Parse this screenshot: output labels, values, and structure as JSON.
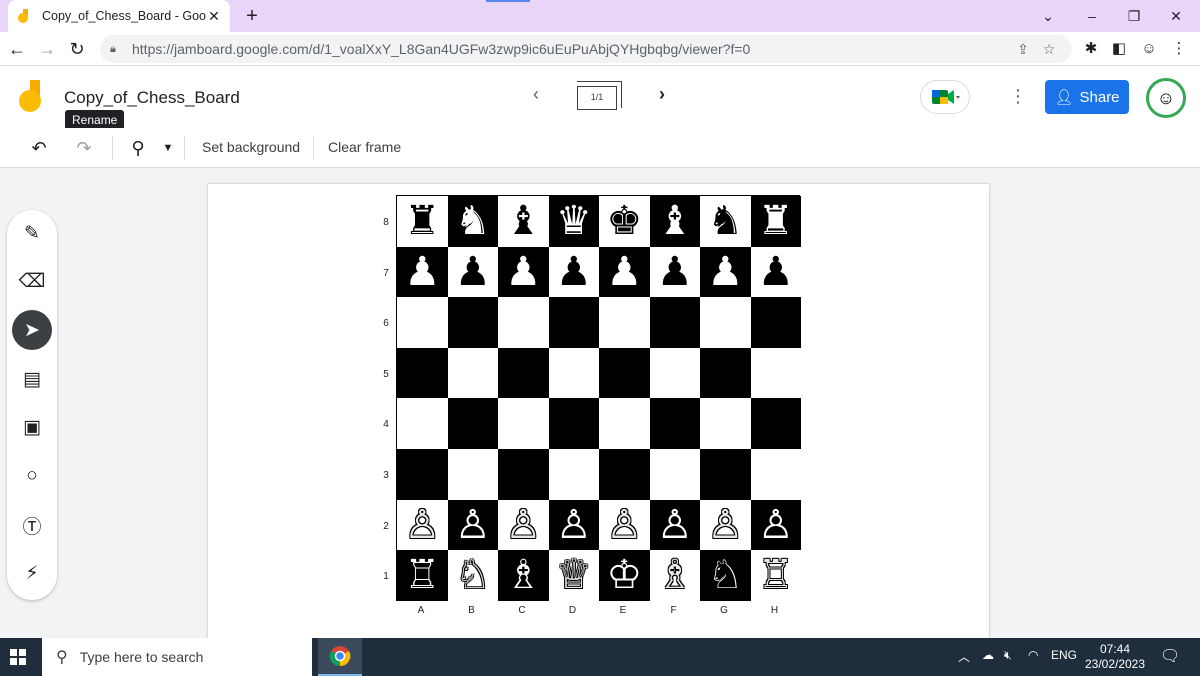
{
  "browser": {
    "tab_title": "Copy_of_Chess_Board - Google Jamboard",
    "url": "https://jamboard.google.com/d/1_voalXxY_L8Gan4UGFw3zwp9ic6uEuPuAbjQYHgbqbg/viewer?f=0"
  },
  "jamboard": {
    "title": "Copy_of_Chess_Board",
    "tooltip": "Rename",
    "frame_indicator": "1/1",
    "share_label": "Share",
    "set_background": "Set background",
    "clear_frame": "Clear frame"
  },
  "board": {
    "ranks": [
      "8",
      "7",
      "6",
      "5",
      "4",
      "3",
      "2",
      "1"
    ],
    "files": [
      "A",
      "B",
      "C",
      "D",
      "E",
      "F",
      "G",
      "H"
    ],
    "rows": [
      [
        "♜",
        "♞",
        "♝",
        "♛",
        "♚",
        "♝",
        "♞",
        "♜"
      ],
      [
        "♟",
        "♟",
        "♟",
        "♟",
        "♟",
        "♟",
        "♟",
        "♟"
      ],
      [
        "",
        "",
        "",
        "",
        "",
        "",
        "",
        ""
      ],
      [
        "",
        "",
        "",
        "",
        "",
        "",
        "",
        ""
      ],
      [
        "",
        "",
        "",
        "",
        "",
        "",
        "",
        ""
      ],
      [
        "",
        "",
        "",
        "",
        "",
        "",
        "",
        ""
      ],
      [
        "♙",
        "♙",
        "♙",
        "♙",
        "♙",
        "♙",
        "♙",
        "♙"
      ],
      [
        "♖",
        "♘",
        "♗",
        "♕",
        "♔",
        "♗",
        "♘",
        "♖"
      ]
    ],
    "piece_colors": [
      [
        "black",
        "black",
        "black",
        "black",
        "black",
        "black",
        "black",
        "black"
      ],
      [
        "black",
        "black",
        "black",
        "black",
        "black",
        "black",
        "black",
        "black"
      ],
      [
        "",
        "",
        "",
        "",
        "",
        "",
        "",
        ""
      ],
      [
        "",
        "",
        "",
        "",
        "",
        "",
        "",
        ""
      ],
      [
        "",
        "",
        "",
        "",
        "",
        "",
        "",
        ""
      ],
      [
        "",
        "",
        "",
        "",
        "",
        "",
        "",
        ""
      ],
      [
        "white",
        "white",
        "white",
        "white",
        "white",
        "white",
        "white",
        "white"
      ],
      [
        "white",
        "white",
        "white",
        "white",
        "white",
        "white",
        "white",
        "white"
      ]
    ]
  },
  "taskbar": {
    "search_placeholder": "Type here to search",
    "language": "ENG",
    "time": "07:44",
    "date": "23/02/2023"
  },
  "colors": {
    "accent": "#1a73e8",
    "tab_strip": "#e9d5f7",
    "taskbar": "#1f2d3d"
  }
}
